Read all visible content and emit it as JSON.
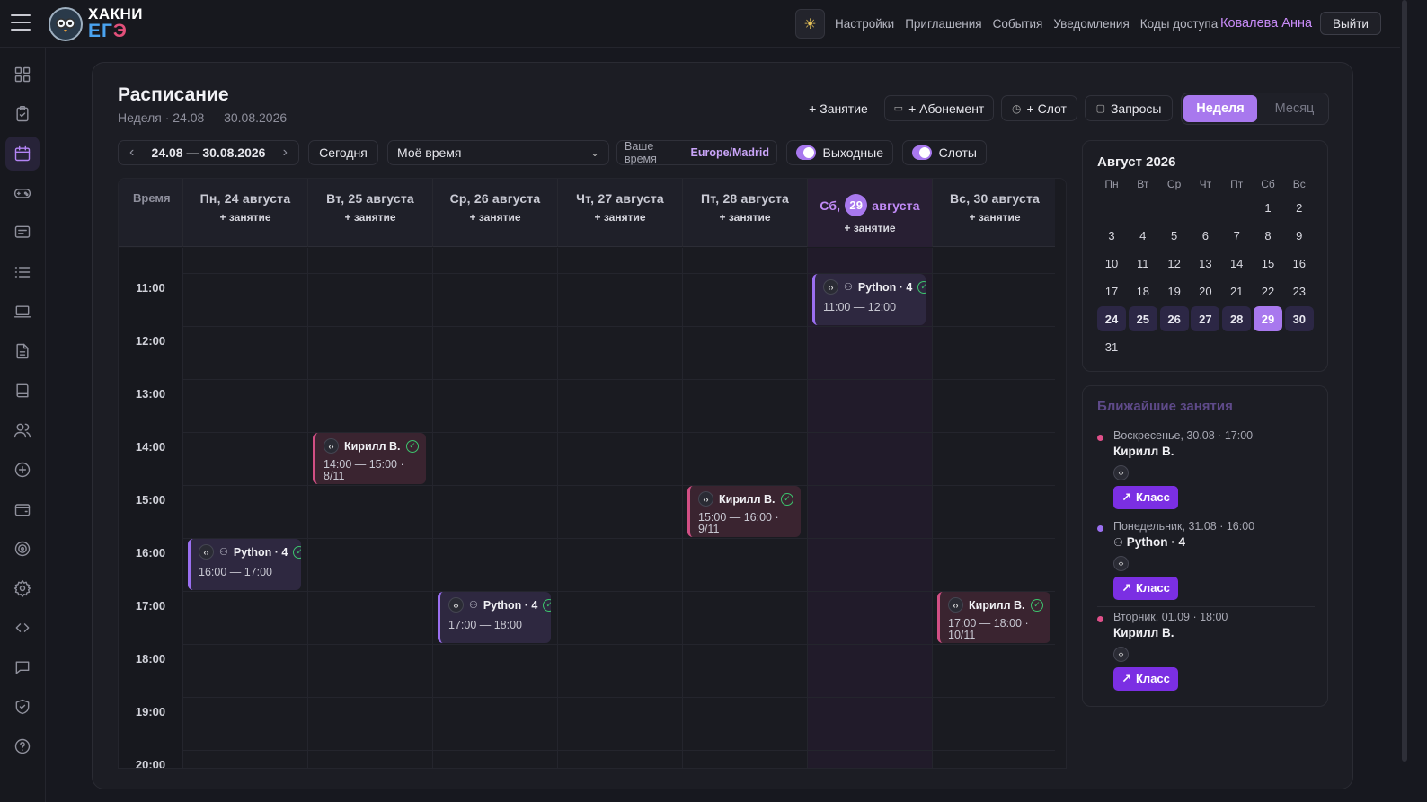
{
  "header": {
    "brand_line1": "ХАКНИ",
    "brand_line2_a": "ЕГ",
    "brand_line2_b": "Э",
    "nav": [
      "Настройки",
      "Приглашения",
      "События",
      "Уведомления",
      "Коды доступа"
    ],
    "user": "Ковалева Анна",
    "logout": "Выйти"
  },
  "page": {
    "title": "Расписание",
    "subtitle": "Неделя · 24.08 — 30.08.2026"
  },
  "toolbar": {
    "add_lesson": "+ Занятие",
    "add_subscription": "+ Абонемент",
    "add_slot": "+ Слот",
    "requests": "Запросы",
    "view_week": "Неделя",
    "view_month": "Месяц"
  },
  "controls": {
    "range": "24.08 — 30.08.2026",
    "today": "Сегодня",
    "time_mode": "Моё время",
    "tz_label": "Ваше время",
    "tz_value": "Europe/Madrid",
    "weekends": "Выходные",
    "slots": "Слоты"
  },
  "grid": {
    "time_header": "Время",
    "add_label": "+ занятие",
    "days": [
      {
        "name": "Пн, 24 августа"
      },
      {
        "name": "Вт, 25 августа"
      },
      {
        "name": "Ср, 26 августа"
      },
      {
        "name": "Чт, 27 августа"
      },
      {
        "name": "Пт, 28 августа"
      },
      {
        "prefix": "Сб,",
        "num": "29",
        "suffix": "августа"
      },
      {
        "name": "Вс, 30 августа"
      }
    ],
    "hours": [
      "11:00",
      "12:00",
      "13:00",
      "14:00",
      "15:00",
      "16:00",
      "17:00",
      "18:00",
      "19:00",
      "20:00"
    ]
  },
  "events": [
    {
      "day": 5,
      "color": "purple",
      "title": "Python · 4",
      "time": "11:00 — 12:00",
      "group": true
    },
    {
      "day": 1,
      "color": "pink",
      "title": "Кирилл В.",
      "time": "14:00 — 15:00 · 8/11",
      "group": false
    },
    {
      "day": 4,
      "color": "pink",
      "title": "Кирилл В.",
      "time": "15:00 — 16:00 · 9/11",
      "group": false
    },
    {
      "day": 0,
      "color": "purple",
      "title": "Python · 4",
      "time": "16:00 — 17:00",
      "group": true
    },
    {
      "day": 2,
      "color": "purple",
      "title": "Python · 4",
      "time": "17:00 — 18:00",
      "group": true
    },
    {
      "day": 6,
      "color": "pink",
      "title": "Кирилл В.",
      "time": "17:00 — 18:00 · 10/11",
      "group": false
    }
  ],
  "mini_calendar": {
    "title": "Август 2026",
    "dow": [
      "Пн",
      "Вт",
      "Ср",
      "Чт",
      "Пт",
      "Сб",
      "Вс"
    ],
    "days": [
      "1",
      "2",
      "3",
      "4",
      "5",
      "6",
      "7",
      "8",
      "9",
      "10",
      "11",
      "12",
      "13",
      "14",
      "15",
      "16",
      "17",
      "18",
      "19",
      "20",
      "21",
      "22",
      "23",
      "24",
      "25",
      "26",
      "27",
      "28",
      "29",
      "30",
      "31"
    ],
    "selected": "29",
    "week": [
      "24",
      "25",
      "26",
      "27",
      "28",
      "29",
      "30"
    ]
  },
  "upcoming": {
    "title": "Ближайшие занятия",
    "items": [
      {
        "date": "Воскресенье, 30.08 · 17:00",
        "who": "Кирилл В.",
        "group": false,
        "dot": "#e0508a",
        "btn": "Класс"
      },
      {
        "date": "Понедельник, 31.08 · 16:00",
        "who": "Python · 4",
        "group": true,
        "dot": "#9a6ff0",
        "btn": "Класс"
      },
      {
        "date": "Вторник, 01.09 · 18:00",
        "who": "Кирилл В.",
        "group": false,
        "dot": "#e0508a",
        "btn": "Класс"
      }
    ]
  },
  "icons": {
    "code": "code-icon",
    "check": "check-circle-icon",
    "group": "users-icon",
    "external": "arrow-up-right-icon"
  }
}
